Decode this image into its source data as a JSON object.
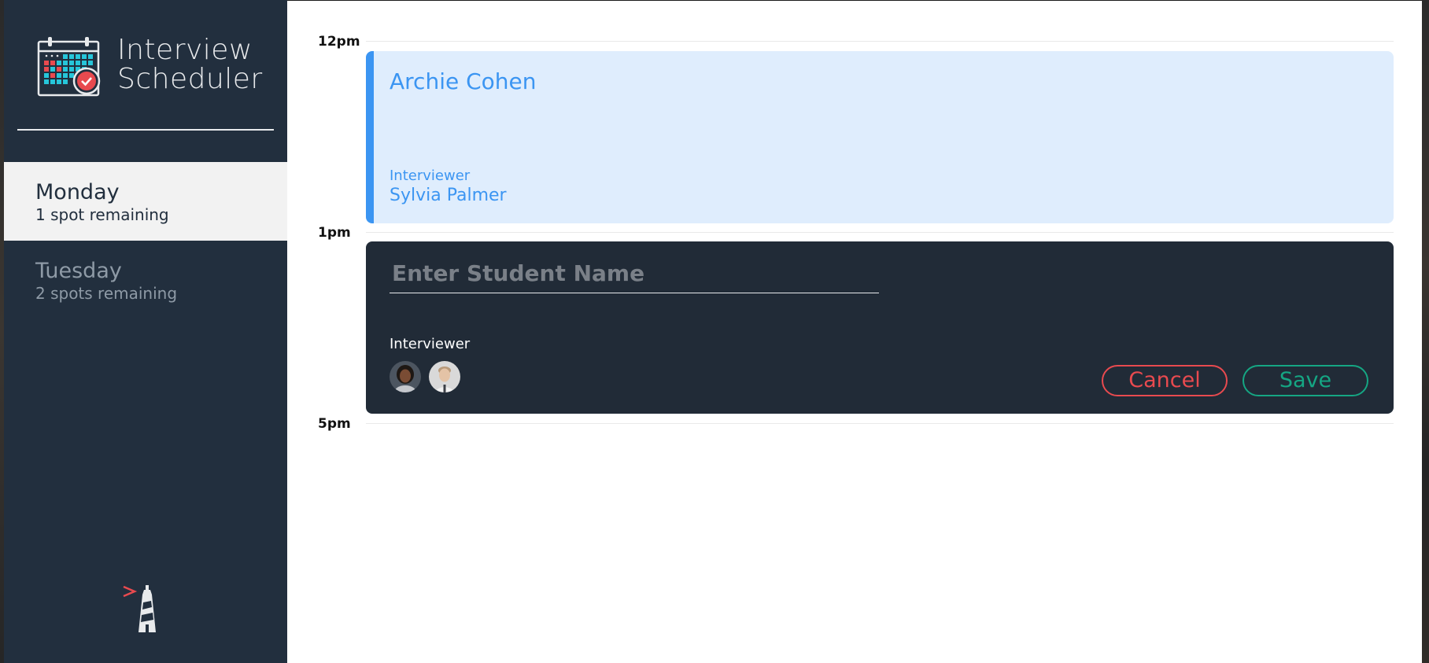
{
  "app": {
    "title_line1": "Interview",
    "title_line2": "Scheduler",
    "title": "Interview\nScheduler"
  },
  "sidebar": {
    "days": [
      {
        "name": "Monday",
        "spots": "1 spot remaining",
        "selected": true
      },
      {
        "name": "Tuesday",
        "spots": "2 spots remaining",
        "selected": false
      }
    ]
  },
  "schedule": {
    "hours": [
      "12pm",
      "1pm",
      "5pm"
    ],
    "appointment": {
      "student": "Archie Cohen",
      "interviewer_label": "Interviewer",
      "interviewer_name": "Sylvia Palmer"
    },
    "form": {
      "placeholder": "Enter Student Name",
      "interviewer_label": "Interviewer",
      "avatars": [
        "interviewer-avatar-1",
        "interviewer-avatar-2"
      ],
      "cancel_label": "Cancel",
      "save_label": "Save"
    }
  },
  "colors": {
    "sidebar_bg": "#222f3e",
    "accent_blue": "#3b95f2",
    "cancel_red": "#e84a4f",
    "save_green": "#15a683",
    "form_bg": "#212b37"
  }
}
